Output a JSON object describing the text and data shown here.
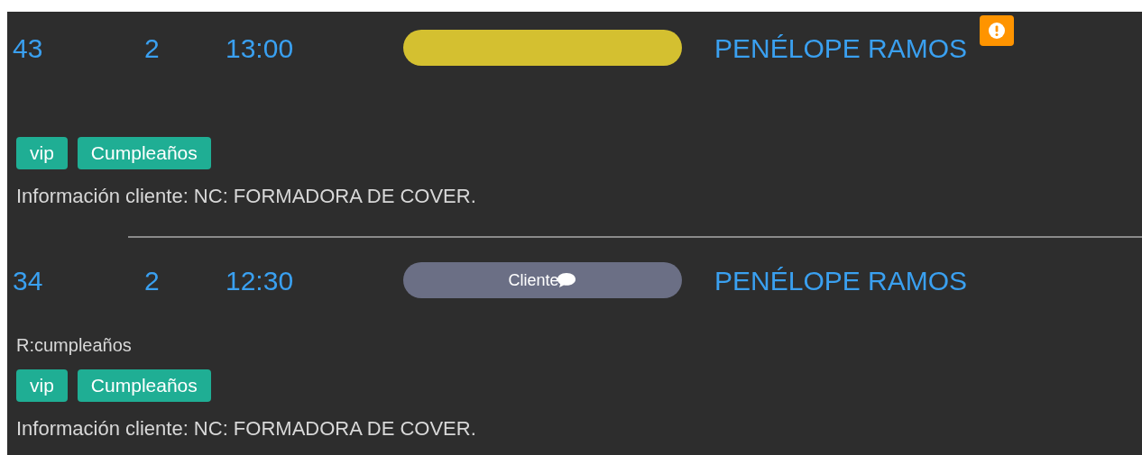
{
  "reservations": [
    {
      "table": "43",
      "guests": "2",
      "time": "13:00",
      "status": {
        "color": "#d4c030"
      },
      "name": "PENÉLOPE RAMOS",
      "alert": true,
      "tags": [
        "vip",
        "Cumpleaños"
      ],
      "client_info": "Información cliente: NC: FORMADORA DE COVER."
    },
    {
      "table": "34",
      "guests": "2",
      "time": "12:30",
      "status": {
        "color": "#6b6f85",
        "label": "Cliente",
        "comment": true
      },
      "name": "PENÉLOPE RAMOS",
      "alert": false,
      "note": "R:cumpleaños",
      "tags": [
        "vip",
        "Cumpleaños"
      ],
      "client_info": "Información cliente: NC: FORMADORA DE COVER."
    }
  ]
}
